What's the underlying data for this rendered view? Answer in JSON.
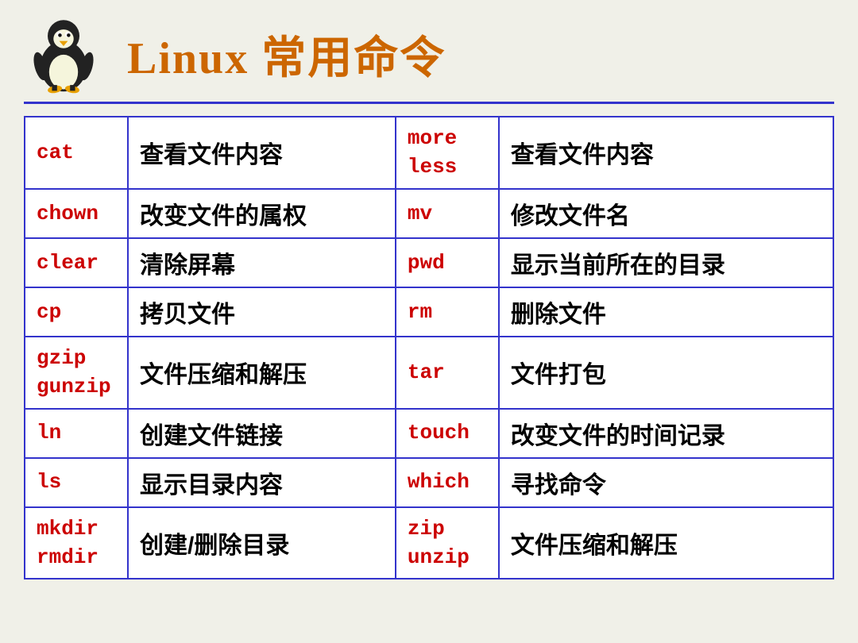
{
  "header": {
    "title": "Linux 常用命令"
  },
  "rows": [
    {
      "cmd1": "cat",
      "desc1": "查看文件内容",
      "cmd2": "more\nless",
      "desc2": "查看文件内容"
    },
    {
      "cmd1": "chown",
      "desc1": "改变文件的属权",
      "cmd2": "mv",
      "desc2": "修改文件名"
    },
    {
      "cmd1": "clear",
      "desc1": "清除屏幕",
      "cmd2": "pwd",
      "desc2": "显示当前所在的目录"
    },
    {
      "cmd1": "cp",
      "desc1": "拷贝文件",
      "cmd2": "rm",
      "desc2": "删除文件"
    },
    {
      "cmd1": "gzip\ngunzip",
      "desc1": "文件压缩和解压",
      "cmd2": "tar",
      "desc2": "文件打包"
    },
    {
      "cmd1": "ln",
      "desc1": "创建文件链接",
      "cmd2": "touch",
      "desc2": "改变文件的时间记录"
    },
    {
      "cmd1": "ls",
      "desc1": "显示目录内容",
      "cmd2": "which",
      "desc2": "寻找命令"
    },
    {
      "cmd1": "mkdir\nrmdir",
      "desc1": "创建/删除目录",
      "cmd2": "zip\nunzip",
      "desc2": "文件压缩和解压"
    }
  ]
}
